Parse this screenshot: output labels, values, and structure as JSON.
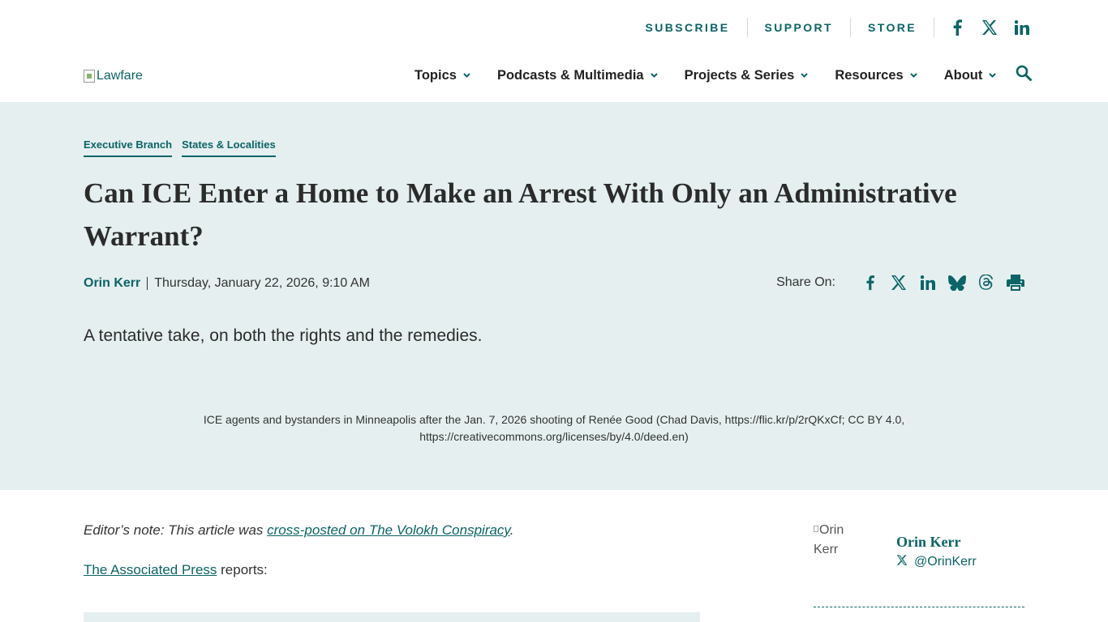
{
  "header": {
    "utility_links": [
      "SUBSCRIBE",
      "SUPPORT",
      "STORE"
    ],
    "social_icons": [
      "facebook-icon",
      "x-icon",
      "linkedin-icon"
    ],
    "logo_alt": "Lawfare",
    "nav": [
      {
        "label": "Topics"
      },
      {
        "label": "Podcasts & Multimedia"
      },
      {
        "label": "Projects & Series"
      },
      {
        "label": "Resources"
      },
      {
        "label": "About"
      }
    ]
  },
  "article": {
    "tags": [
      "Executive Branch",
      "States & Localities"
    ],
    "title": "Can ICE Enter a Home to Make an Arrest With Only an Administrative Warrant?",
    "author": "Orin Kerr",
    "date": "Thursday, January 22, 2026, 9:10 AM",
    "share_label": "Share On:",
    "share_icons": [
      "facebook-icon",
      "x-icon",
      "linkedin-icon",
      "bluesky-icon",
      "threads-icon",
      "print-icon"
    ],
    "dek": "A tentative take, on both the rights and the remedies.",
    "caption": "ICE agents and bystanders in Minneapolis after the Jan. 7, 2026 shooting of Renée Good (Chad Davis, https://flic.kr/p/2rQKxCf; CC BY 4.0, https://creativecommons.org/licenses/by/4.0/deed.en)"
  },
  "body": {
    "editor_note_prefix": "Editor’s note: This article was ",
    "editor_note_link": "cross-posted on The Volokh Conspiracy",
    "editor_note_suffix": ".",
    "ap_link": "The Associated Press",
    "ap_suffix": " reports:"
  },
  "sidebar": {
    "avatar_alt": "Orin Kerr",
    "name": "Orin Kerr",
    "handle": "@OrinKerr"
  },
  "colors": {
    "accent": "#0b6467",
    "hero_bg": "#e6efef"
  }
}
